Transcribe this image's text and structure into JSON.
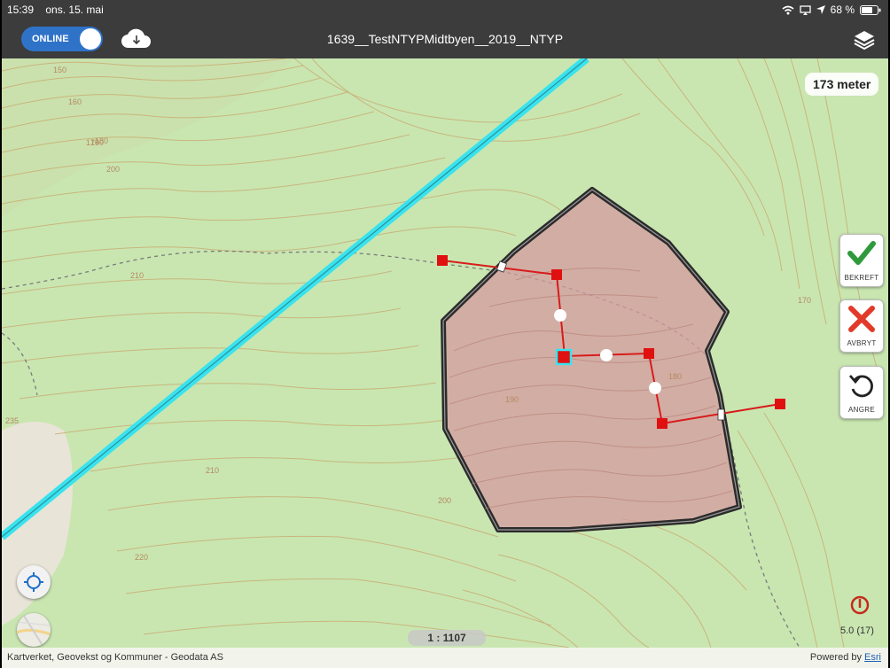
{
  "status_bar": {
    "time": "15:39",
    "date": "ons. 15. mai",
    "battery": "68 %"
  },
  "nav": {
    "online_label": "ONLINE",
    "title": "1639__TestNTYPMidtbyen__2019__NTYP"
  },
  "map": {
    "scale_bar": "173 meter",
    "scale": "1 : 1107",
    "contour_labels": [
      "150",
      "160",
      "170",
      "180",
      "190",
      "200",
      "210",
      "220",
      "235",
      "180",
      "190",
      "200",
      "210",
      "170"
    ],
    "gps_accuracy": "5.0 (17)",
    "attribution": "Kartverket, Geovekst og Kommuner - Geodata AS",
    "powered_by": "Powered by",
    "powered_by_link": "Esri"
  },
  "tools": {
    "confirm": "BEKREFT",
    "cancel": "AVBRYT",
    "undo": "ANGRE"
  },
  "colors": {
    "polygon_fill": "#d49aa0",
    "polygon_outline": "#2b2b2b",
    "edit_line": "#d81b1b",
    "powerline": "#39e3ee",
    "map_bg": "#c9e6b1"
  },
  "icons": [
    "wifi-icon",
    "battery-icon",
    "location-arrow-icon",
    "download-cloud-icon",
    "layers-icon",
    "checkmark-icon",
    "close-icon",
    "undo-icon",
    "locate-icon",
    "basemap-icon",
    "compass-icon"
  ]
}
